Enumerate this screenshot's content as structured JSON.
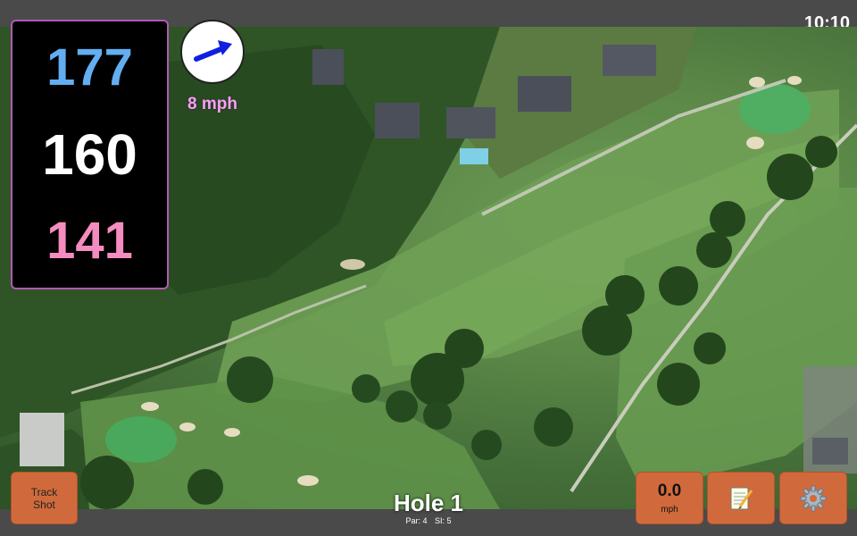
{
  "status_bar": {
    "time": "10:10"
  },
  "distances": {
    "back": "177",
    "middle": "160",
    "front": "141"
  },
  "wind": {
    "speed_label": "8 mph",
    "direction_icon": "wind-arrow-icon"
  },
  "buttons": {
    "track_shot_line1": "Track",
    "track_shot_line2": "Shot",
    "wind_value": "0.0",
    "wind_unit": "mph",
    "notes_icon": "notepad-icon",
    "settings_icon": "gear-icon"
  },
  "hole": {
    "title": "Hole 1",
    "par": "Par: 4",
    "si": "SI: 5"
  },
  "colors": {
    "back": "#62aef0",
    "middle": "#ffffff",
    "front": "#f58cc0",
    "panel_border": "#b05ab4",
    "button": "#d06a3c",
    "wind_text": "#f2a3f0"
  }
}
